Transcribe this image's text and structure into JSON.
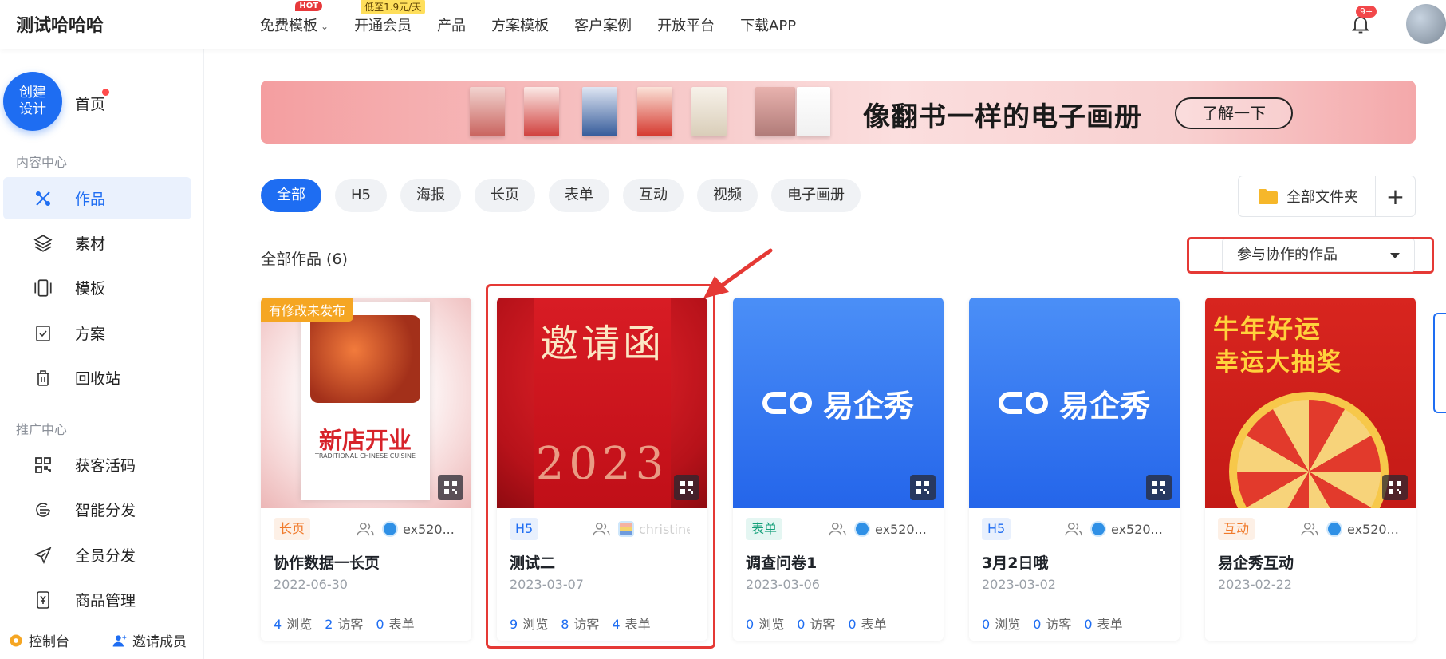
{
  "header": {
    "brand": "测试哈哈哈",
    "nav": [
      {
        "label": "免费模板",
        "badge": "HOT",
        "chevron": true
      },
      {
        "label": "开通会员",
        "price_badge": "低至1.9元/天"
      },
      {
        "label": "产品"
      },
      {
        "label": "方案模板"
      },
      {
        "label": "客户案例"
      },
      {
        "label": "开放平台"
      },
      {
        "label": "下载APP"
      }
    ],
    "notification_count": "9+"
  },
  "sidebar": {
    "create_label": "创建\n设计",
    "home_label": "首页",
    "section_content": "内容中心",
    "content_items": [
      {
        "label": "作品",
        "icon": "works-icon",
        "active": true
      },
      {
        "label": "素材",
        "icon": "layers-icon"
      },
      {
        "label": "模板",
        "icon": "template-icon"
      },
      {
        "label": "方案",
        "icon": "checklist-icon"
      },
      {
        "label": "回收站",
        "icon": "trash-icon"
      }
    ],
    "section_promo": "推广中心",
    "promo_items": [
      {
        "label": "获客活码",
        "icon": "qrcode-icon"
      },
      {
        "label": "智能分发",
        "icon": "distribute-icon"
      },
      {
        "label": "全员分发",
        "icon": "send-icon"
      },
      {
        "label": "商品管理",
        "icon": "product-icon"
      }
    ],
    "footer_console": "控制台",
    "footer_invite": "邀请成员"
  },
  "banner": {
    "title": "像翻书一样的电子画册",
    "button": "了解一下"
  },
  "filters": [
    "全部",
    "H5",
    "海报",
    "长页",
    "表单",
    "互动",
    "视频",
    "电子画册"
  ],
  "active_filter": "全部",
  "folder_button": "全部文件夹",
  "list_title": "全部作品 (6)",
  "sort_select": "参与协作的作品",
  "cards": [
    {
      "type_tag": "长页",
      "tag_style": "orange",
      "collaborator": "ex520...",
      "title": "协作数据一长页",
      "date": "2022-06-30",
      "views": "4",
      "visitors": "2",
      "forms": "0",
      "unpublished": "有修改未发布",
      "views_label": "浏览",
      "visitors_label": "访客",
      "forms_label": "表单"
    },
    {
      "type_tag": "H5",
      "tag_style": "blue",
      "collaborator": "christine",
      "title": "测试二",
      "date": "2023-03-07",
      "views": "9",
      "visitors": "8",
      "forms": "4",
      "views_label": "浏览",
      "visitors_label": "访客",
      "forms_label": "表单"
    },
    {
      "type_tag": "表单",
      "tag_style": "teal",
      "collaborator": "ex520...",
      "title": "调查问卷1",
      "date": "2023-03-06",
      "views": "0",
      "visitors": "0",
      "forms": "0",
      "views_label": "浏览",
      "visitors_label": "访客",
      "forms_label": "表单",
      "cover_text": "易企秀"
    },
    {
      "type_tag": "H5",
      "tag_style": "blue",
      "collaborator": "ex520...",
      "title": "3月2日哦",
      "date": "2023-03-02",
      "views": "0",
      "visitors": "0",
      "forms": "0",
      "views_label": "浏览",
      "visitors_label": "访客",
      "forms_label": "表单",
      "cover_text": "易企秀"
    },
    {
      "type_tag": "互动",
      "tag_style": "orange",
      "collaborator": "ex520...",
      "title": "易企秀互动",
      "date": "2023-02-22"
    }
  ],
  "covers": {
    "shop_title": "新店开业",
    "shop_sub": "TRADITIONAL CHINESE CUISINE",
    "invite_big": "邀请函",
    "invite_year": "2023",
    "lottery_line1": "牛年好运",
    "lottery_line2": "幸运大抽奖"
  },
  "colors": {
    "accent": "#1e6df2",
    "highlight": "#e53935",
    "unpublished": "#f5a623"
  }
}
